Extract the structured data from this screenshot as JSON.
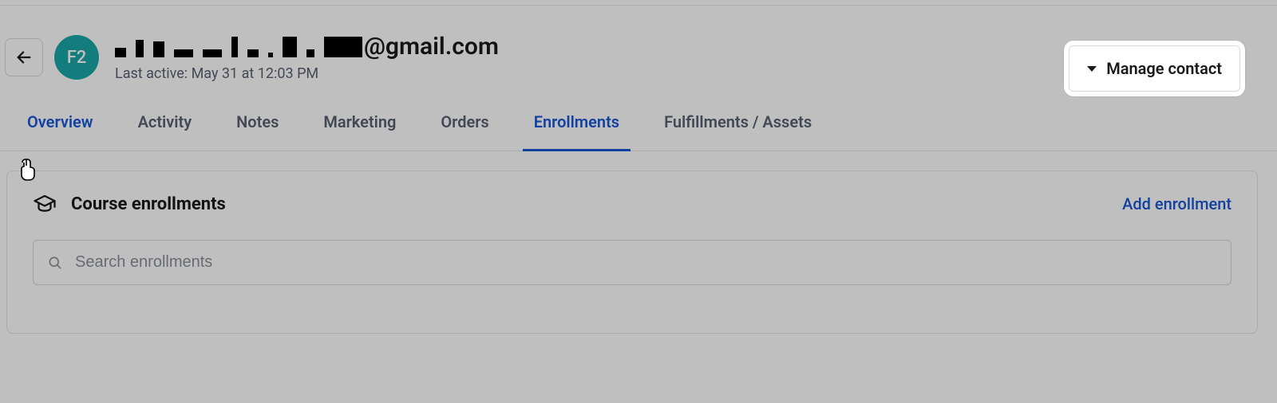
{
  "header": {
    "avatar_initials": "F2",
    "email_suffix": "@gmail.com",
    "last_active": "Last active: May 31 at 12:03 PM",
    "manage_label": "Manage contact"
  },
  "tabs": {
    "overview": "Overview",
    "activity": "Activity",
    "notes": "Notes",
    "marketing": "Marketing",
    "orders": "Orders",
    "enrollments": "Enrollments",
    "fulfillments": "Fulfillments / Assets"
  },
  "panel": {
    "title": "Course enrollments",
    "add_label": "Add enrollment",
    "search_placeholder": "Search enrollments"
  }
}
